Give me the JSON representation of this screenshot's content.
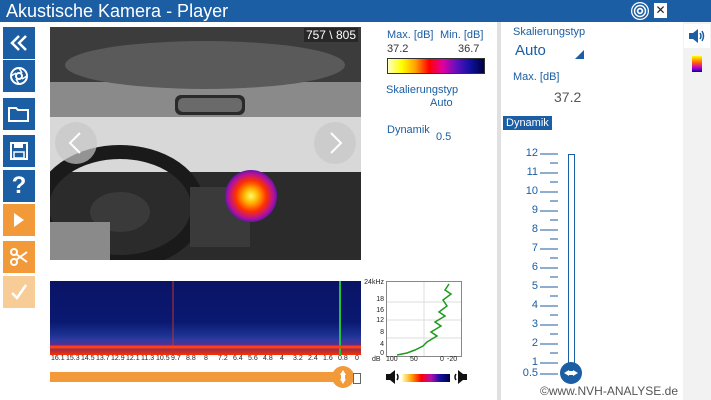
{
  "app": {
    "title": "Akustische Kamera - Player"
  },
  "video": {
    "frame_counter": "757 \\ 805"
  },
  "level_info": {
    "max_label": "Max. [dB]",
    "min_label": "Min. [dB]",
    "max_value": "37.2",
    "min_value": "36.7",
    "scaling_type_label": "Skalierungstyp",
    "scaling_type_value": "Auto",
    "dynamic_label": "Dynamik",
    "dynamic_value": "0.5"
  },
  "spectrogram": {
    "x_ticks": [
      "16.1",
      "15.3",
      "14.5",
      "13.7",
      "12.9",
      "12.1",
      "11.3",
      "10.5",
      "9.7",
      "8.8",
      "8",
      "7.2",
      "6.4",
      "5.6",
      "4.8",
      "4",
      "3.2",
      "2.4",
      "1.6",
      "0.8",
      "0"
    ]
  },
  "spectrum": {
    "y_ticks": [
      "24kHz",
      "18",
      "16",
      "12",
      "8",
      "4",
      "0"
    ],
    "x_axis": {
      "unit": "dB",
      "ticks": [
        "100",
        "50",
        "0",
        "-20"
      ]
    }
  },
  "playback": {
    "position_fraction": 0.94
  },
  "settings": {
    "scaling_type_label": "Skalierungstyp",
    "scaling_type_value": "Auto",
    "max_label": "Max. [dB]",
    "max_value": "37.2",
    "dynamic_label": "Dynamik",
    "scale_ticks": [
      "12",
      "11",
      "10",
      "9",
      "8",
      "7",
      "6",
      "5",
      "4",
      "3",
      "2",
      "1"
    ],
    "dynamic_min_tick": "0.5",
    "dynamic_value": "0.5"
  },
  "copyright": "©www.NVH-ANALYSE.de"
}
